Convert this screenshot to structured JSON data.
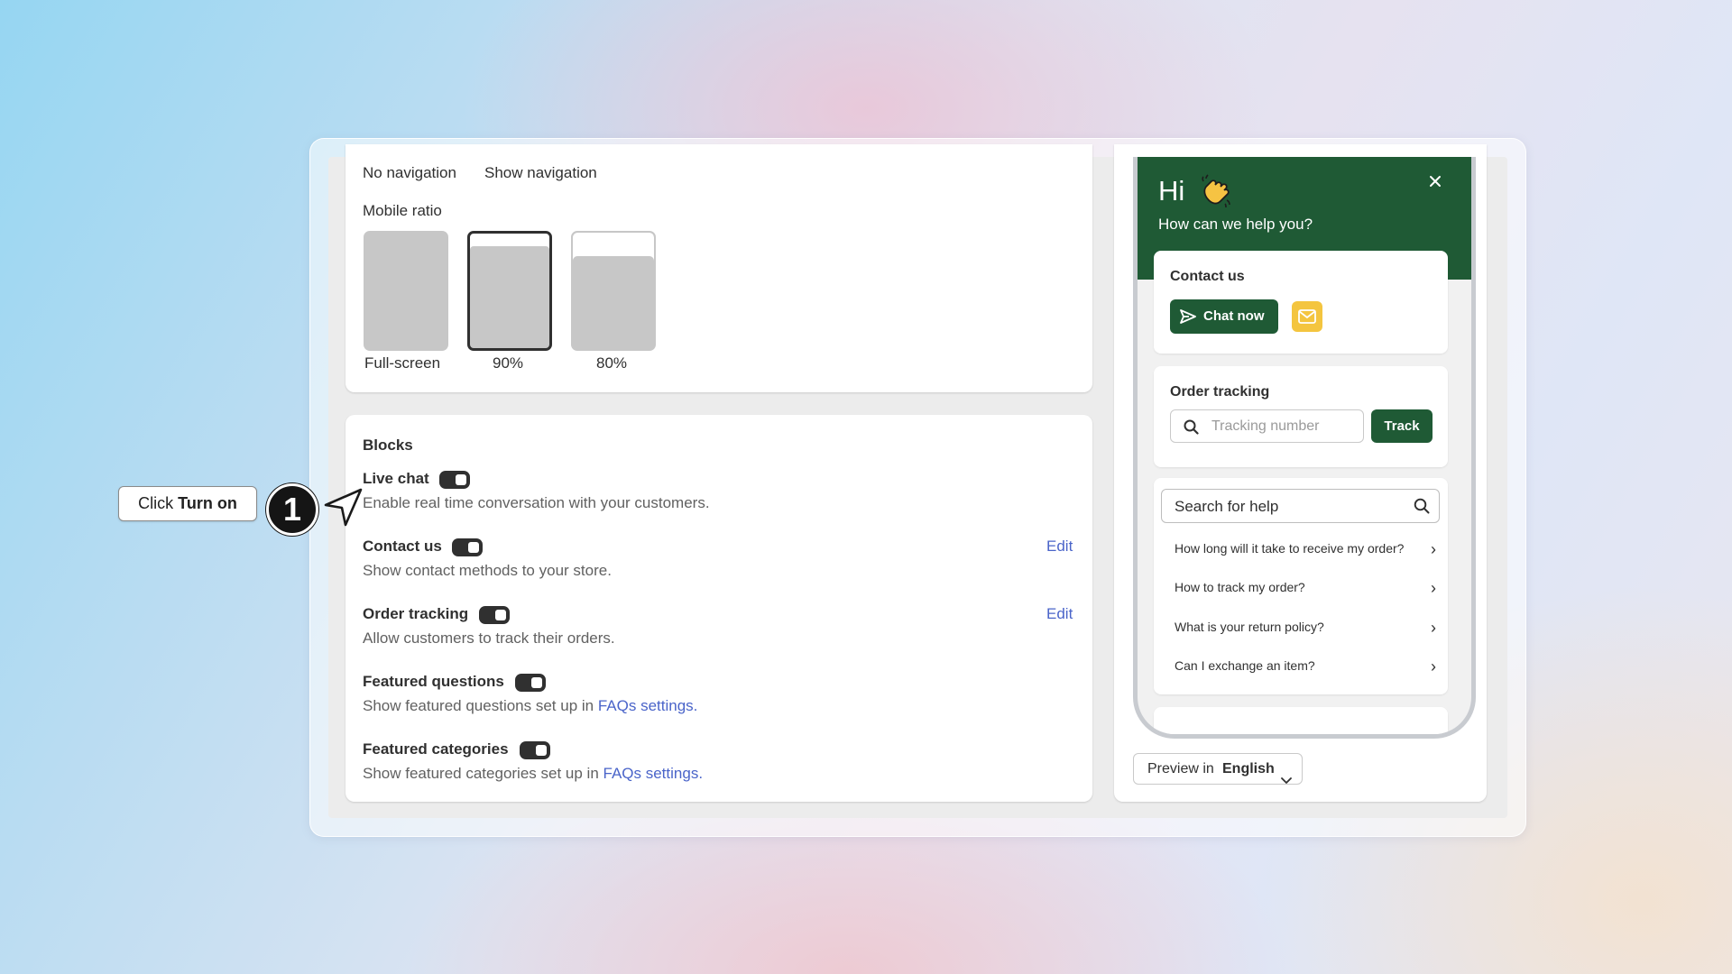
{
  "callout": {
    "prefix": "Click ",
    "action": "Turn on",
    "step_number": "1"
  },
  "settings": {
    "navigation_options": [
      "No navigation",
      "Show navigation"
    ],
    "mobile_ratio_label": "Mobile ratio",
    "ratios": [
      {
        "label": "Full-screen",
        "selected": false
      },
      {
        "label": "90%",
        "selected": true
      },
      {
        "label": "80%",
        "selected": false
      }
    ],
    "blocks_title": "Blocks",
    "blocks": [
      {
        "name": "Live chat",
        "desc": "Enable real time conversation with your customers.",
        "enabled": true
      },
      {
        "name": "Contact us",
        "desc": "Show contact methods to your store.",
        "edit": "Edit",
        "enabled": true
      },
      {
        "name": "Order tracking",
        "desc": "Allow customers to track their orders.",
        "edit": "Edit",
        "enabled": true
      },
      {
        "name": "Featured questions",
        "desc": "Show featured questions set up in ",
        "link": "FAQs settings.",
        "enabled": true
      },
      {
        "name": "Featured categories",
        "desc": "Show featured categories set up in ",
        "link": "FAQs settings.",
        "enabled": true
      }
    ]
  },
  "preview": {
    "greeting": "Hi",
    "greeting_icon": "waving-hand-icon",
    "subtitle": "How can we help you?",
    "contact_title": "Contact us",
    "chat_button": "Chat now",
    "tracking_title": "Order tracking",
    "tracking_placeholder": "Tracking number",
    "track_button": "Track",
    "search_placeholder": "Search for help",
    "faqs": [
      "How long will it take to receive my order?",
      "How to track my order?",
      "What is your return policy?",
      "Can I exchange an item?"
    ],
    "language_prefix": "Preview in ",
    "language": "English"
  },
  "colors": {
    "brand_green": "#1f5a35",
    "mail_yellow": "#f4c53f",
    "link_blue": "#4a64c9"
  }
}
